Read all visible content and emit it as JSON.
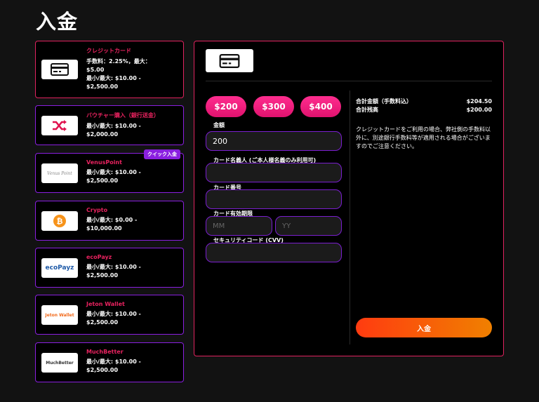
{
  "page": {
    "title": "入金"
  },
  "methods": [
    {
      "name": "クレジットカード",
      "lines": [
        "手数料：2.25%，最大：",
        "$5.00",
        "最小/最大: $10.00 -",
        "$2,500.00"
      ],
      "logo": "credit-card-icon"
    },
    {
      "name": "バウチャー購入（銀行送金）",
      "lines": [
        "最小/最大: $10.00 -",
        "$2,000.00"
      ],
      "logo": "shuffle-icon"
    },
    {
      "name": "VenusPoint",
      "lines": [
        "最小/最大: $10.00 -",
        "$2,500.00"
      ],
      "logo_text": "Venus Point",
      "badge": "クイック入金"
    },
    {
      "name": "Crypto",
      "lines": [
        "最小/最大: $0.00 -",
        "$10,000.00"
      ],
      "logo": "bitcoin-icon"
    },
    {
      "name": "ecoPayz",
      "lines": [
        "最小/最大: $10.00 -",
        "$2,500.00"
      ],
      "logo_text": "ecoPayz"
    },
    {
      "name": "Jeton Wallet",
      "lines": [
        "最小/最大: $10.00 -",
        "$2,500.00"
      ],
      "logo_text": "Jeton Wallet"
    },
    {
      "name": "MuchBetter",
      "lines": [
        "最小/最大: $10.00 -",
        "$2,500.00"
      ],
      "logo_text": "MuchBetter"
    }
  ],
  "amount_buttons": [
    "$200",
    "$300",
    "$400"
  ],
  "form": {
    "amount_label": "金額",
    "amount_value": "200",
    "holder_label": "カード名義人 (ご本人様名義のみ利用可)",
    "number_label": "カード番号",
    "expiry_label": "カード有効期限",
    "expiry_month_placeholder": "MM",
    "expiry_year_placeholder": "YY",
    "cvv_label": "セキュリティコード (CVV)"
  },
  "summary": {
    "total_label": "合計金額（手数料込）",
    "total_value": "$204.50",
    "balance_label": "合計残高",
    "balance_value": "$200.00",
    "note": "クレジットカードをご利用の場合、弊社側の手数料以外に、別途銀行手数料等が適用される場合がございますのでご注意ください。"
  },
  "submit_label": "入金",
  "colors": {
    "accent": "#e0235f",
    "purple": "#8a1fe0",
    "button": "#ff2d8f",
    "submit": "#ff3b10"
  }
}
